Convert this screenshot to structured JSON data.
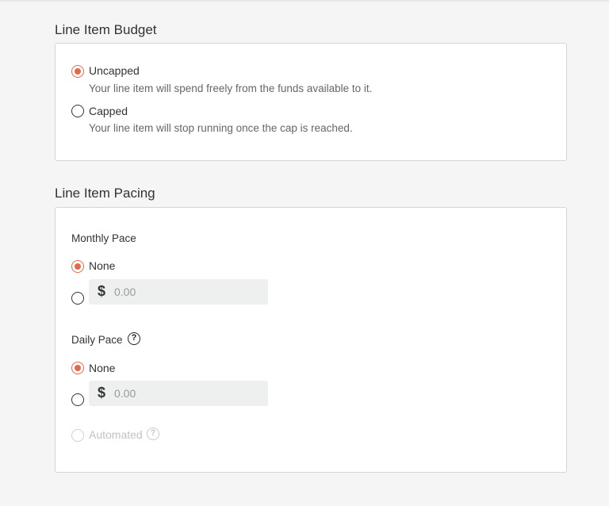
{
  "budget": {
    "title": "Line Item Budget",
    "options": [
      {
        "label": "Uncapped",
        "description": "Your line item will spend freely from the funds available to it.",
        "selected": true
      },
      {
        "label": "Capped",
        "description": "Your line item will stop running once the cap is reached.",
        "selected": false
      }
    ]
  },
  "pacing": {
    "title": "Line Item Pacing",
    "monthly": {
      "label": "Monthly Pace",
      "none_label": "None",
      "currency_symbol": "$",
      "amount_placeholder": "0.00"
    },
    "daily": {
      "label": "Daily Pace",
      "help_glyph": "?",
      "none_label": "None",
      "currency_symbol": "$",
      "amount_placeholder": "0.00",
      "automated_label": "Automated",
      "automated_help_glyph": "?"
    }
  },
  "colors": {
    "accent": "#e4694a",
    "background": "#f5f5f5",
    "input_bg": "#eef0ef"
  },
  "icons": {
    "help": "question-circle-icon",
    "selected_radio": "radio-checked-icon",
    "unselected_radio": "radio-unchecked-icon"
  }
}
